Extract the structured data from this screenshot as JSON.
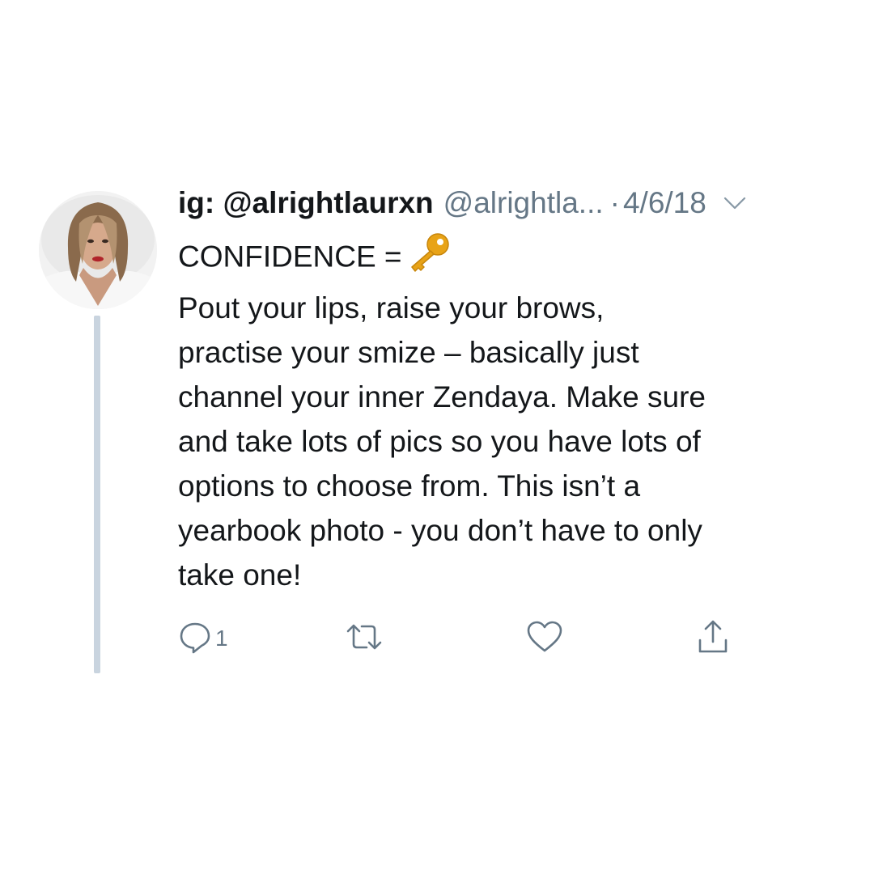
{
  "tweet": {
    "display_name": "ig: @alrightlaurxn",
    "handle": "@alrightla...",
    "separator": "·",
    "date": "4/6/18",
    "body_first_line": "CONFIDENCE =",
    "body_first_line_emoji": "key-emoji",
    "body_lines": [
      "Pout your lips, raise your brows,",
      "practise your smize – basically just",
      "channel your inner Zendaya. Make sure",
      "and take lots of pics so you have lots of",
      "options to choose from. This isn’t a",
      "yearbook photo - you don’t have to only",
      "take one!"
    ]
  },
  "actions": {
    "reply_icon": "reply-icon",
    "reply_count": "1",
    "retweet_icon": "retweet-icon",
    "like_icon": "heart-icon",
    "share_icon": "share-icon"
  },
  "colors": {
    "text": "#14171a",
    "secondary": "#657786",
    "thread_line": "#c9d4df",
    "key_gold": "#e8a317"
  }
}
